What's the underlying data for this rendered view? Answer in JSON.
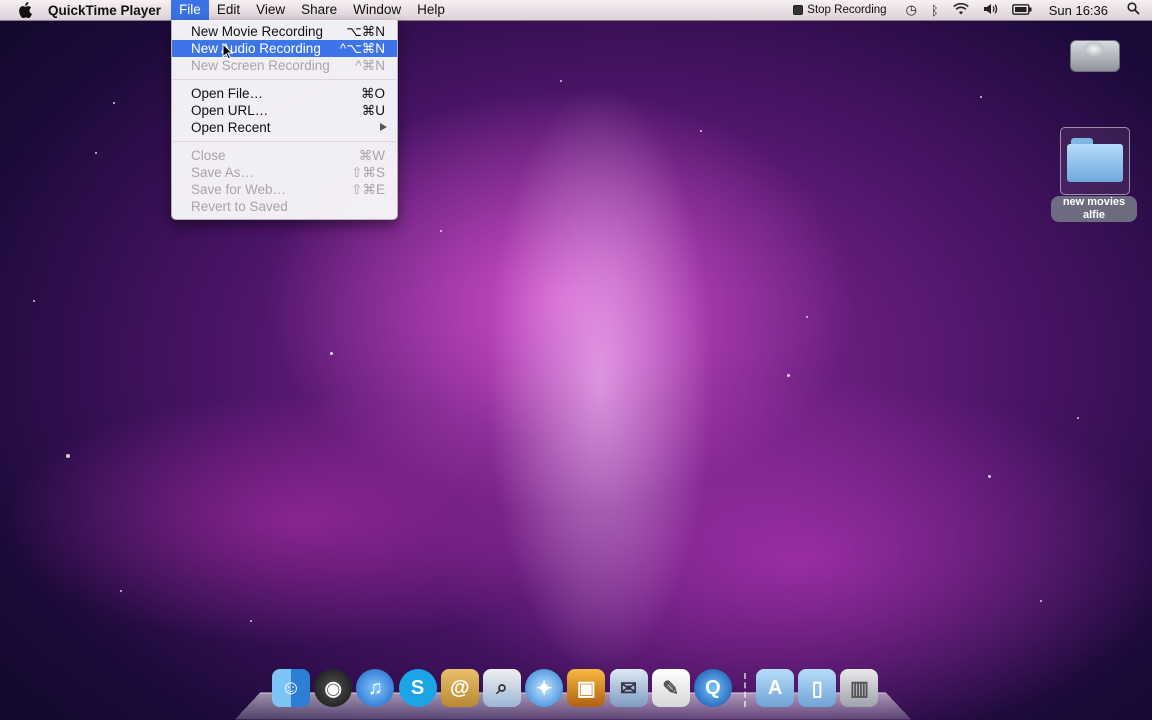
{
  "menubar": {
    "app_name": "QuickTime Player",
    "menus": [
      "File",
      "Edit",
      "View",
      "Share",
      "Window",
      "Help"
    ],
    "active_menu": "File",
    "status": {
      "recording_label": "Stop Recording",
      "clock": "Sun 16:36",
      "icons": [
        "stop-recording-icon",
        "time-machine-icon",
        "bluetooth-icon",
        "wifi-icon",
        "volume-icon",
        "battery-icon",
        "spotlight-icon"
      ]
    }
  },
  "file_menu": {
    "items": [
      {
        "label": "New Movie Recording",
        "shortcut": "⌥⌘N",
        "enabled": true,
        "highlighted": false
      },
      {
        "label": "New Audio Recording",
        "shortcut": "^⌥⌘N",
        "enabled": true,
        "highlighted": true
      },
      {
        "label": "New Screen Recording",
        "shortcut": "^⌘N",
        "enabled": false,
        "highlighted": false
      },
      {
        "label": "Open File…",
        "shortcut": "⌘O",
        "enabled": true,
        "highlighted": false
      },
      {
        "label": "Open URL…",
        "shortcut": "⌘U",
        "enabled": true,
        "highlighted": false
      },
      {
        "label": "Open Recent",
        "shortcut": "",
        "enabled": true,
        "highlighted": false,
        "submenu": true
      },
      {
        "label": "Close",
        "shortcut": "⌘W",
        "enabled": false,
        "highlighted": false
      },
      {
        "label": "Save As…",
        "shortcut": "⇧⌘S",
        "enabled": false,
        "highlighted": false
      },
      {
        "label": "Save for Web…",
        "shortcut": "⇧⌘E",
        "enabled": false,
        "highlighted": false
      },
      {
        "label": "Revert to Saved",
        "shortcut": "",
        "enabled": false,
        "highlighted": false
      }
    ]
  },
  "desktop": {
    "icons": [
      {
        "name": "hard-drive-icon",
        "label": ""
      },
      {
        "name": "folder-icon",
        "label": "new movies alfie"
      }
    ]
  },
  "dock": {
    "apps": [
      "finder-icon",
      "dashboard-icon",
      "itunes-icon",
      "skype-icon",
      "address-book-icon",
      "preview-icon",
      "safari-icon",
      "iphoto-icon",
      "mail-icon",
      "textedit-icon",
      "quicktime-icon",
      "applications-folder-icon",
      "documents-folder-icon",
      "trash-icon"
    ],
    "colors": {
      "accent": "#3b73e6"
    }
  }
}
